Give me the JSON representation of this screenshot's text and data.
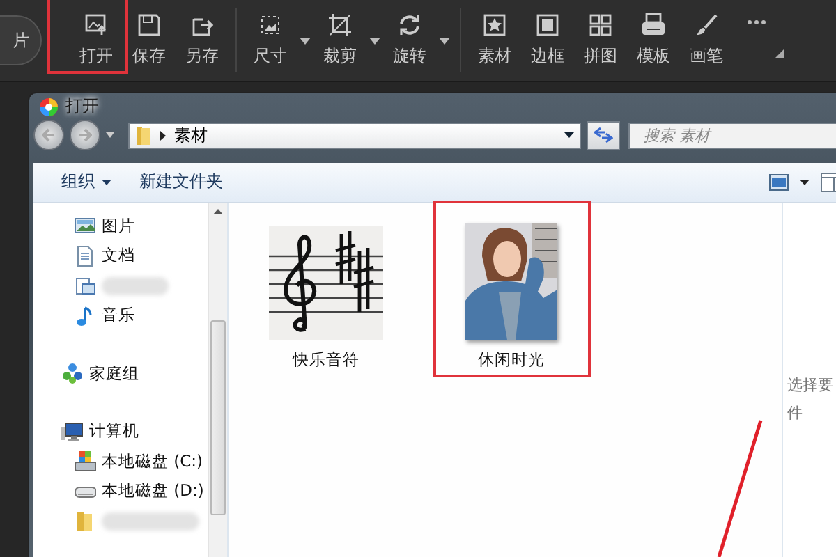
{
  "toolbar": {
    "partial_button": "片",
    "items": [
      {
        "label": "打开",
        "kind": "open",
        "dropdown": false,
        "highlighted": true,
        "group_end": false
      },
      {
        "label": "保存",
        "kind": "save",
        "dropdown": false,
        "highlighted": false,
        "group_end": false
      },
      {
        "label": "另存",
        "kind": "save-as",
        "dropdown": false,
        "highlighted": false,
        "group_end": true
      },
      {
        "label": "尺寸",
        "kind": "resize",
        "dropdown": true,
        "highlighted": false,
        "group_end": false
      },
      {
        "label": "裁剪",
        "kind": "crop",
        "dropdown": true,
        "highlighted": false,
        "group_end": false
      },
      {
        "label": "旋转",
        "kind": "rotate",
        "dropdown": true,
        "highlighted": false,
        "group_end": true
      },
      {
        "label": "素材",
        "kind": "star",
        "dropdown": false,
        "highlighted": false,
        "group_end": false
      },
      {
        "label": "边框",
        "kind": "frame",
        "dropdown": false,
        "highlighted": false,
        "group_end": false
      },
      {
        "label": "拼图",
        "kind": "grid",
        "dropdown": false,
        "highlighted": false,
        "group_end": false
      },
      {
        "label": "模板",
        "kind": "template",
        "dropdown": false,
        "highlighted": false,
        "group_end": false
      },
      {
        "label": "画笔",
        "kind": "brush",
        "dropdown": false,
        "highlighted": false,
        "group_end": false
      }
    ]
  },
  "dialog": {
    "title": "打开",
    "breadcrumb": "素材",
    "search": {
      "placeholder": "搜索 素材"
    },
    "commands": [
      {
        "label": "组织",
        "dropdown": true
      },
      {
        "label": "新建文件夹",
        "dropdown": false
      }
    ],
    "nav": [
      {
        "kind": "group",
        "children": [
          {
            "label": "图片",
            "kind": "pictures"
          },
          {
            "label": "文档",
            "kind": "documents"
          },
          {
            "kind": "blurred-video"
          },
          {
            "label": "音乐",
            "kind": "music"
          }
        ]
      },
      {
        "label": "家庭组",
        "kind": "homegroup"
      },
      {
        "label": "计算机",
        "kind": "computer",
        "children": [
          {
            "label": "本地磁盘 (C:)",
            "kind": "system-drive"
          },
          {
            "label": "本地磁盘 (D:)",
            "kind": "drive"
          },
          {
            "kind": "blurred-folder"
          }
        ]
      }
    ],
    "files": [
      {
        "name": "快乐音符",
        "kind": "sheet-music",
        "highlighted": false
      },
      {
        "name": "休闲时光",
        "highlighted": true
      }
    ],
    "preview_text": [
      "选择要",
      "件"
    ]
  }
}
